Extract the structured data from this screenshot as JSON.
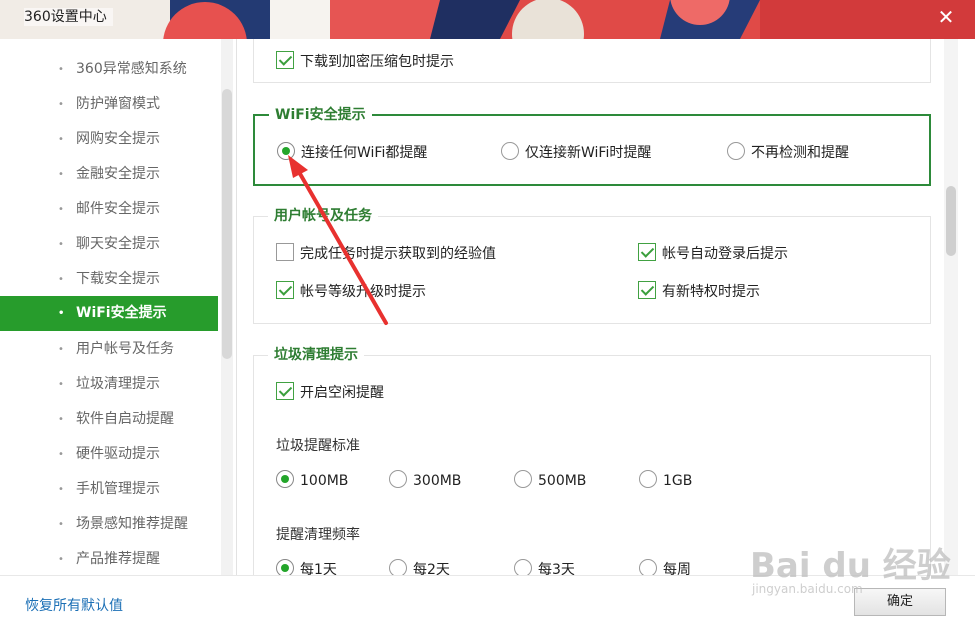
{
  "window": {
    "title": "360设置中心",
    "close_glyph": "✕"
  },
  "sidebar": {
    "items": [
      {
        "label": "360异常感知系统",
        "active": false
      },
      {
        "label": "防护弹窗模式",
        "active": false
      },
      {
        "label": "网购安全提示",
        "active": false
      },
      {
        "label": "金融安全提示",
        "active": false
      },
      {
        "label": "邮件安全提示",
        "active": false
      },
      {
        "label": "聊天安全提示",
        "active": false
      },
      {
        "label": "下载安全提示",
        "active": false
      },
      {
        "label": "WiFi安全提示",
        "active": true
      },
      {
        "label": "用户帐号及任务",
        "active": false
      },
      {
        "label": "垃圾清理提示",
        "active": false
      },
      {
        "label": "软件自启动提醒",
        "active": false
      },
      {
        "label": "硬件驱动提示",
        "active": false
      },
      {
        "label": "手机管理提示",
        "active": false
      },
      {
        "label": "场景感知推荐提醒",
        "active": false
      },
      {
        "label": "产品推荐提醒",
        "active": false
      }
    ],
    "bullet": "•"
  },
  "download_group": {
    "options": [
      {
        "label": "下载到加密压缩包时提示",
        "checked": true
      }
    ]
  },
  "wifi_group": {
    "title": "WiFi安全提示",
    "options": [
      {
        "label": "连接任何WiFi都提醒",
        "selected": true
      },
      {
        "label": "仅连接新WiFi时提醒",
        "selected": false
      },
      {
        "label": "不再检测和提醒",
        "selected": false
      }
    ]
  },
  "account_group": {
    "title": "用户帐号及任务",
    "options": [
      {
        "label": "完成任务时提示获取到的经验值",
        "checked": false
      },
      {
        "label": "帐号自动登录后提示",
        "checked": true
      },
      {
        "label": "帐号等级升级时提示",
        "checked": true
      },
      {
        "label": "有新特权时提示",
        "checked": true
      }
    ]
  },
  "junk_group": {
    "title": "垃圾清理提示",
    "idle_option": {
      "label": "开启空闲提醒",
      "checked": true
    },
    "threshold_label": "垃圾提醒标准",
    "thresholds": [
      {
        "label": "100MB",
        "selected": true
      },
      {
        "label": "300MB",
        "selected": false
      },
      {
        "label": "500MB",
        "selected": false
      },
      {
        "label": "1GB",
        "selected": false
      }
    ],
    "frequency_label": "提醒清理频率",
    "frequencies": [
      {
        "label": "每1天",
        "selected": true
      },
      {
        "label": "每2天",
        "selected": false
      },
      {
        "label": "每3天",
        "selected": false
      },
      {
        "label": "每周",
        "selected": false
      }
    ]
  },
  "footer": {
    "restore_label": "恢复所有默认值",
    "ok_label": "确定"
  },
  "watermark": {
    "main": "Bai du 经验",
    "sub": "jingyan.baidu.com"
  },
  "colors": {
    "accent": "#279c2c",
    "group_title": "#2e7d32",
    "link": "#1b6fb5",
    "annotation_arrow": "#e8312f"
  }
}
